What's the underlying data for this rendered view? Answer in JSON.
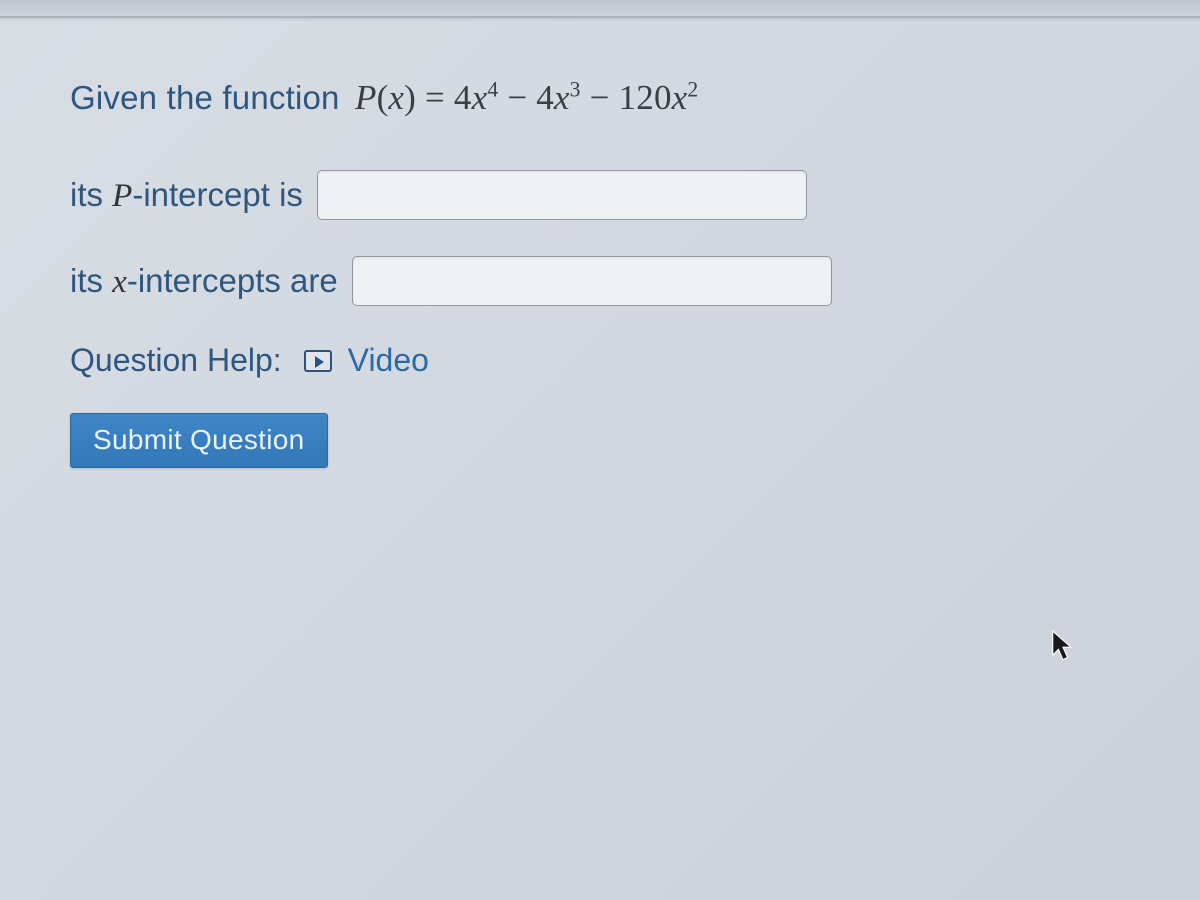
{
  "question": {
    "prefix": "Given the function ",
    "function_letter": "P",
    "variable": "x",
    "equals": " = ",
    "term1_coeff": "4",
    "term1_var": "x",
    "term1_exp": "4",
    "minus1": " − ",
    "term2_coeff": "4",
    "term2_var": "x",
    "term2_exp": "3",
    "minus2": " − ",
    "term3_coeff": "120",
    "term3_var": "x",
    "term3_exp": "2"
  },
  "inputs": {
    "p_label_prefix": "its ",
    "p_label_var": "P",
    "p_label_suffix": "-intercept is",
    "p_value": "",
    "x_label_prefix": "its ",
    "x_label_var": "x",
    "x_label_suffix": "-intercepts are",
    "x_value": ""
  },
  "help": {
    "label": "Question Help:",
    "video_link": "Video"
  },
  "buttons": {
    "submit_label": "Submit Question"
  }
}
